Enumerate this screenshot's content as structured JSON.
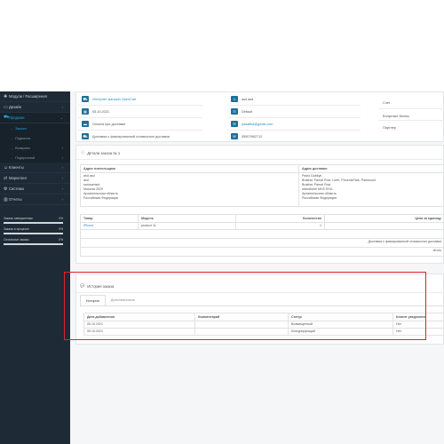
{
  "sidebar": {
    "items": [
      {
        "icon": "puzzle-icon",
        "glyph": "✚",
        "label": "Модули / Расширения",
        "has_arrow": false
      },
      {
        "icon": "monitor-icon",
        "glyph": "▭",
        "label": "Дизайн",
        "has_arrow": true
      },
      {
        "icon": "cart-icon",
        "glyph": "⛟",
        "label": "Продажи",
        "has_arrow": true,
        "active": true
      }
    ],
    "sales_sub": [
      {
        "label": "Заказы",
        "active": true
      },
      {
        "label": "Подписка",
        "has_arrow": false
      },
      {
        "label": "Возвраты",
        "has_arrow": true
      },
      {
        "label": "Подарочный",
        "has_arrow": true
      }
    ],
    "items_after": [
      {
        "icon": "user-icon",
        "glyph": "☺",
        "label": "Клиенты"
      },
      {
        "icon": "share-icon",
        "glyph": "⇄",
        "label": "Маркетинг"
      },
      {
        "icon": "gear-icon",
        "glyph": "⚙",
        "label": "Система"
      },
      {
        "icon": "chart-icon",
        "glyph": "▥",
        "label": "Отчеты"
      }
    ],
    "progress": [
      {
        "label": "Заказы завершенные",
        "percent": "0%",
        "value": 1.0
      },
      {
        "label": "Заказы в процессе",
        "percent": "0%",
        "value": 1.0
      },
      {
        "label": "Остальные заказы",
        "percent": "0%",
        "value": 1.0
      }
    ]
  },
  "order_info": {
    "col1": [
      {
        "icon": "cart-icon",
        "value": "Интернет магазин OpenCart",
        "link": true
      },
      {
        "icon": "calendar-icon",
        "value": "05.10.2021",
        "link": false
      },
      {
        "icon": "credit-card-icon",
        "value": "Оплата при доставке",
        "link": false
      },
      {
        "icon": "truck-icon",
        "value": "Доставка с фиксированной стоимостью доставки",
        "link": false
      }
    ],
    "col2": [
      {
        "icon": "user-icon",
        "value": "asd asd",
        "link": false
      },
      {
        "icon": "group-icon",
        "value": "Default",
        "link": false
      },
      {
        "icon": "envelope-icon",
        "value": "pasaffkd@gmail.com",
        "link": true
      },
      {
        "icon": "phone-icon",
        "value": "05907862712",
        "link": false
      }
    ],
    "col3": [
      {
        "label": "Счет"
      },
      {
        "label": "Бонусные баллы"
      },
      {
        "label": "Партнер"
      }
    ]
  },
  "order_details": {
    "title": "Детали заказа № 1",
    "payment_header": "Адрес плательщика",
    "shipping_header": "Адрес доставки",
    "payment_lines": [
      "asd asd",
      "asd",
      "samsamsnt",
      "Moscow 2020",
      "Архангельская область",
      "Российская Федерация"
    ],
    "shipping_lines": [
      "Pasto Dubkyk",
      "Brakher Parnal Post, Lorth, PhoenixPark, Parkwood",
      "Brakher Parnal Post",
      "Mandtome MH3 5Y0L",
      "Архангельская область",
      "Российская Федерация"
    ]
  },
  "products": {
    "headers": [
      "Товар",
      "Модель",
      "Количество",
      "Цена за единицу"
    ],
    "rows": [
      [
        "iPhone",
        "product 11",
        "1",
        ""
      ]
    ],
    "totals": [
      "Доставка с фиксированной стоимостью доставки",
      "Итого"
    ]
  },
  "history": {
    "title": "История заказа",
    "tabs": [
      "История",
      "Дополнительно"
    ],
    "headers": [
      "Дата добавления",
      "Комментарий",
      "Статус",
      "Клиент уведомлен"
    ],
    "rows": [
      [
        "05.10.2021",
        "",
        "Возмещенный",
        "Нет"
      ],
      [
        "05.10.2021",
        "",
        "Конкурирующий",
        "Нет"
      ]
    ]
  },
  "colors": {
    "sidebar_bg": "#1e2a35",
    "accent": "#1fa1e0",
    "highlight_border": "#d9272e"
  }
}
